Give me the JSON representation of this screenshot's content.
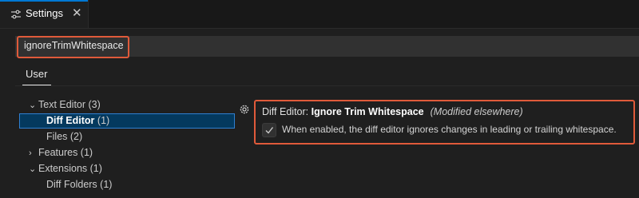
{
  "tab": {
    "label": "Settings",
    "close": "✕"
  },
  "search": {
    "value": "ignoreTrimWhitespace"
  },
  "scope_tabs": {
    "user": "User"
  },
  "toc": {
    "text_editor": "Text Editor (3)",
    "diff_editor_name": "Diff Editor",
    "diff_editor_count": "(1)",
    "files": "Files (2)",
    "features": "Features (1)",
    "extensions": "Extensions (1)",
    "diff_folders": "Diff Folders (1)"
  },
  "setting": {
    "category": "Diff Editor: ",
    "name": "Ignore Trim Whitespace",
    "modified": "(Modified elsewhere)",
    "checked": true,
    "description": "When enabled, the diff editor ignores changes in leading or trailing whitespace."
  },
  "icons": {
    "tab": "settings-sliders-icon",
    "gear": "gear-icon",
    "check": "check-icon",
    "chevron_down": "chevron-down-icon",
    "chevron_right": "chevron-right-icon"
  },
  "colors": {
    "accent": "#0078d4",
    "highlight_border": "#e05a3a",
    "selection_border": "#2f7fd1"
  }
}
